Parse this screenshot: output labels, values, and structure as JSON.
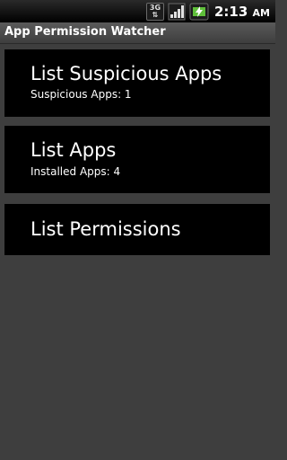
{
  "status_bar": {
    "network_label_top": "3G",
    "network_label_bottom": "⇅",
    "signal_icon": "signal-bars-icon",
    "battery_icon": "battery-charging-icon",
    "time": "2:13",
    "ampm": "AM"
  },
  "app": {
    "title": "App Permission Watcher"
  },
  "menu": {
    "items": [
      {
        "title": "List Suspicious Apps",
        "subtitle": "Suspicious Apps: 1"
      },
      {
        "title": "List Apps",
        "subtitle": "Installed Apps: 4"
      },
      {
        "title": "List Permissions"
      }
    ]
  },
  "colors": {
    "background": "#3e3e3e",
    "item_background": "#000000",
    "text": "#ffffff",
    "battery_accent": "#5fbf3a"
  }
}
